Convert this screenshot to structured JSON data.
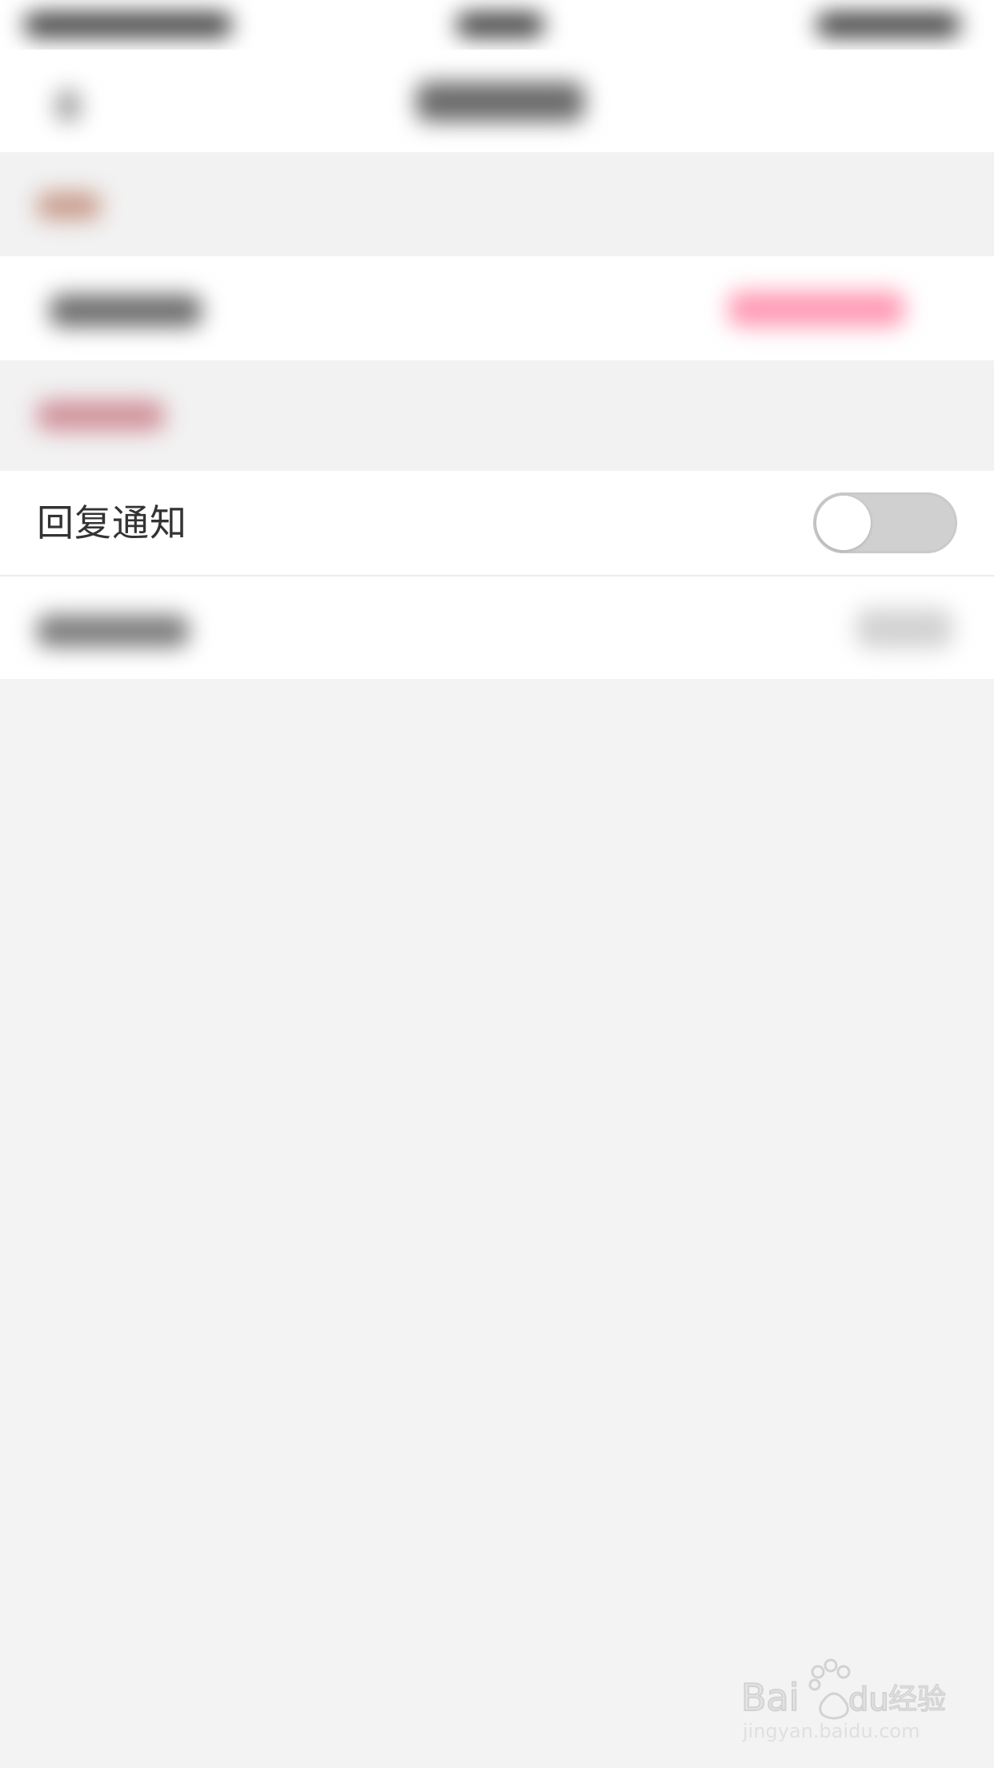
{
  "settings": {
    "reply_notification": {
      "label": "回复通知",
      "enabled": false
    }
  },
  "colors": {
    "background": "#f3f3f3",
    "row_background": "#ffffff",
    "text": "#333333",
    "toggle_off": "#d0d0d0"
  }
}
